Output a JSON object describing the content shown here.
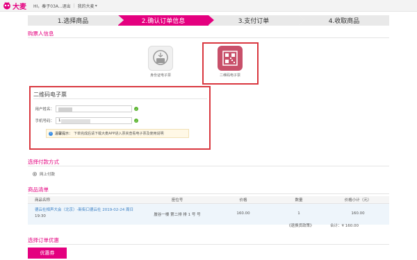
{
  "header": {
    "brand": "大麦",
    "greeting": "HI，秦子03A...退出",
    "my_damai": "我的大麦",
    "caret": "▾"
  },
  "steps": [
    {
      "label": "1.选择商品",
      "active": false
    },
    {
      "label": "2.确认订单信息",
      "active": true
    },
    {
      "label": "3.支付订单",
      "active": false
    },
    {
      "label": "4.收取商品",
      "active": false
    }
  ],
  "buyer_section": {
    "title": "购票人信息",
    "options": [
      {
        "label": "身份证电子票",
        "icon": "id-card-wallet-icon"
      },
      {
        "label": "二维码电子票",
        "icon": "qr-code-icon"
      }
    ]
  },
  "qr_panel": {
    "title": "二维码电子票",
    "name_label": "用户姓名：",
    "phone_label": "手机号码：",
    "phone_value": "1",
    "tip_label": "温馨提示：",
    "tip_text": "下单完成后请下载大麦APP进入票夹查看电子票及使用说明"
  },
  "payment": {
    "title": "选择付款方式",
    "option": "网上付款"
  },
  "goods": {
    "title": "商品清单",
    "headers": [
      "商品名称",
      "座位号",
      "价格",
      "数量",
      "价格小计（元）"
    ],
    "row": {
      "name_line1": "德云社相声大会（北京）-新街口德云社 2019-02-24 周日",
      "name_line2": "19:30",
      "seat": "蜃谷一楼 第二排 排 1 号 号",
      "price": "160.00",
      "qty": "1",
      "subtotal": "160.00"
    },
    "refund_link": "《退换货政策》",
    "total": "合计：¥ 160.00"
  },
  "discount": {
    "title": "选择订单优惠",
    "coupon_btn": "优惠券"
  },
  "colors": {
    "accent": "#e4007f",
    "highlight_border": "#d9363e"
  }
}
